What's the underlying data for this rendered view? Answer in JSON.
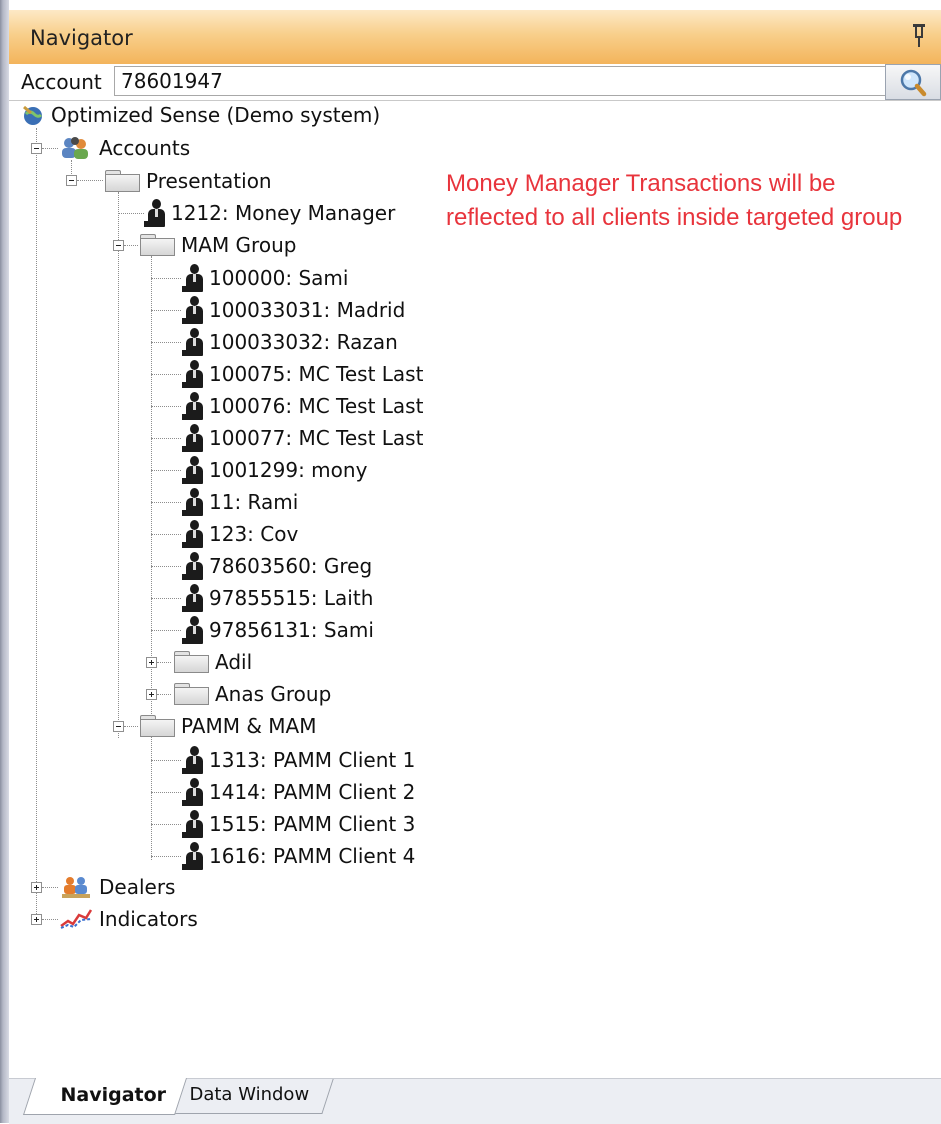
{
  "window": {
    "title": "Navigator"
  },
  "account": {
    "label": "Account",
    "value": "78601947"
  },
  "tree": {
    "root": "Optimized Sense (Demo system)",
    "accounts": "Accounts",
    "presentation": "Presentation",
    "money_manager": "1212: Money Manager",
    "mam_group": "MAM Group",
    "mam_clients": [
      "100000: Sami",
      "100033031: Madrid",
      "100033032: Razan",
      "100075: MC Test Last",
      "100076: MC Test Last",
      "100077: MC Test Last",
      "1001299: mony",
      "11: Rami",
      "123: Cov",
      "78603560: Greg",
      "97855515: Laith",
      "97856131: Sami"
    ],
    "adil": "Adil",
    "anas_group": "Anas Group",
    "pamm_mam": "PAMM & MAM",
    "pamm_clients": [
      "1313: PAMM Client 1",
      "1414: PAMM Client 2",
      "1515: PAMM Client 3",
      "1616: PAMM Client 4"
    ],
    "dealers": "Dealers",
    "indicators": "Indicators"
  },
  "annotation": {
    "text": "Money Manager Transactions will be reflected to all clients inside targeted group",
    "color": "#e8343c"
  },
  "tabs": {
    "navigator": "Navigator",
    "data_window": "Data Window"
  },
  "colors": {
    "titlebar": "#f8cf8b",
    "annotation": "#e8343c"
  },
  "icons": {
    "root": "globe-icon",
    "accounts": "people-group-icon",
    "folder": "folder-icon",
    "client": "person-icon",
    "dealers": "dealers-icon",
    "indicators": "indicators-icon",
    "search": "magnifier-icon",
    "pin": "pin-icon"
  }
}
